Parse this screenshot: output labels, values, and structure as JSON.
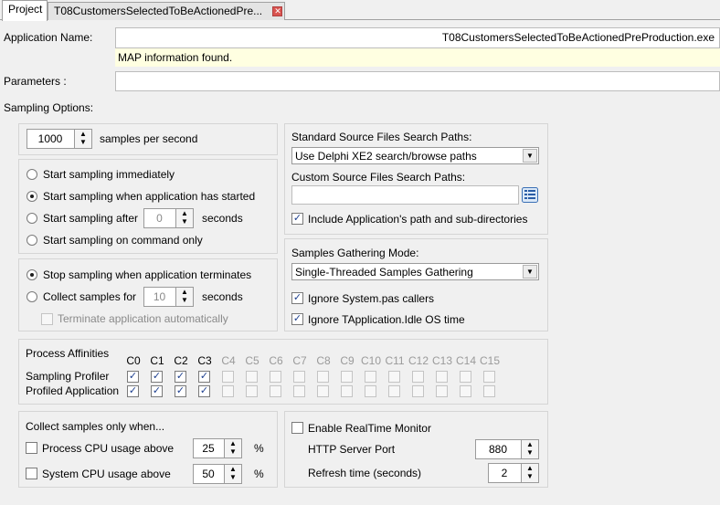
{
  "tabs": [
    {
      "label": "Project",
      "active": true
    },
    {
      "label": "T08CustomersSelectedToBeActionedPre...",
      "active": false
    }
  ],
  "application_name": {
    "label": "Application Name:",
    "value": "T08CustomersSelectedToBeActionedPreProduction.exe",
    "info": "MAP information found."
  },
  "parameters": {
    "label": "Parameters :",
    "value": ""
  },
  "sampling_options_label": "Sampling Options:",
  "rate": {
    "value": "1000",
    "suffix": "samples per second"
  },
  "start": {
    "options": [
      {
        "label": "Start sampling immediately",
        "selected": false
      },
      {
        "label": "Start sampling when application has started",
        "selected": true
      },
      {
        "label": "Start sampling after",
        "selected": false
      },
      {
        "label": "Start sampling on command only",
        "selected": false
      }
    ],
    "after_value": "0",
    "after_unit": "seconds"
  },
  "stop": {
    "options": [
      {
        "label": "Stop sampling when application terminates",
        "selected": true
      },
      {
        "label": "Collect samples for",
        "selected": false
      }
    ],
    "collect_value": "10",
    "collect_unit": "seconds",
    "terminate_label": "Terminate application automatically",
    "terminate_checked": false
  },
  "source_paths": {
    "standard_label": "Standard Source Files Search Paths:",
    "standard_value": "Use Delphi XE2 search/browse paths",
    "custom_label": "Custom Source Files Search Paths:",
    "custom_value": "",
    "include_label": "Include Application's path and sub-directories",
    "include_checked": true
  },
  "gathering": {
    "label": "Samples Gathering Mode:",
    "value": "Single-Threaded Samples Gathering",
    "ignore_system_label": "Ignore System.pas callers",
    "ignore_system_checked": true,
    "ignore_idle_label": "Ignore TApplication.Idle OS time",
    "ignore_idle_checked": true
  },
  "affinities": {
    "title": "Process Affinities",
    "cores": [
      "C0",
      "C1",
      "C2",
      "C3",
      "C4",
      "C5",
      "C6",
      "C7",
      "C8",
      "C9",
      "C10",
      "C11",
      "C12",
      "C13",
      "C14",
      "C15"
    ],
    "enabled_cores": 4,
    "rows": [
      {
        "label": "Sampling Profiler",
        "checked": [
          true,
          true,
          true,
          true,
          false,
          false,
          false,
          false,
          false,
          false,
          false,
          false,
          false,
          false,
          false,
          false
        ]
      },
      {
        "label": "Profiled Application",
        "checked": [
          true,
          true,
          true,
          true,
          false,
          false,
          false,
          false,
          false,
          false,
          false,
          false,
          false,
          false,
          false,
          false
        ]
      }
    ]
  },
  "collect_when": {
    "title": "Collect samples only when...",
    "process_cpu_label": "Process CPU usage above",
    "process_cpu_checked": false,
    "process_cpu_value": "25",
    "system_cpu_label": "System CPU usage above",
    "system_cpu_checked": false,
    "system_cpu_value": "50",
    "unit": "%"
  },
  "realtime": {
    "label": "Enable RealTime Monitor",
    "checked": false,
    "port_label": "HTTP Server Port",
    "port_value": "880",
    "refresh_label": "Refresh time (seconds)",
    "refresh_value": "2"
  },
  "colors": {
    "info_bg": "#ffffe1",
    "check_color": "#1d3f8f",
    "disabled_text": "#8a8a8a"
  },
  "icons": {
    "browse_paths": "folder-list-icon",
    "tab_close": "close-icon"
  }
}
